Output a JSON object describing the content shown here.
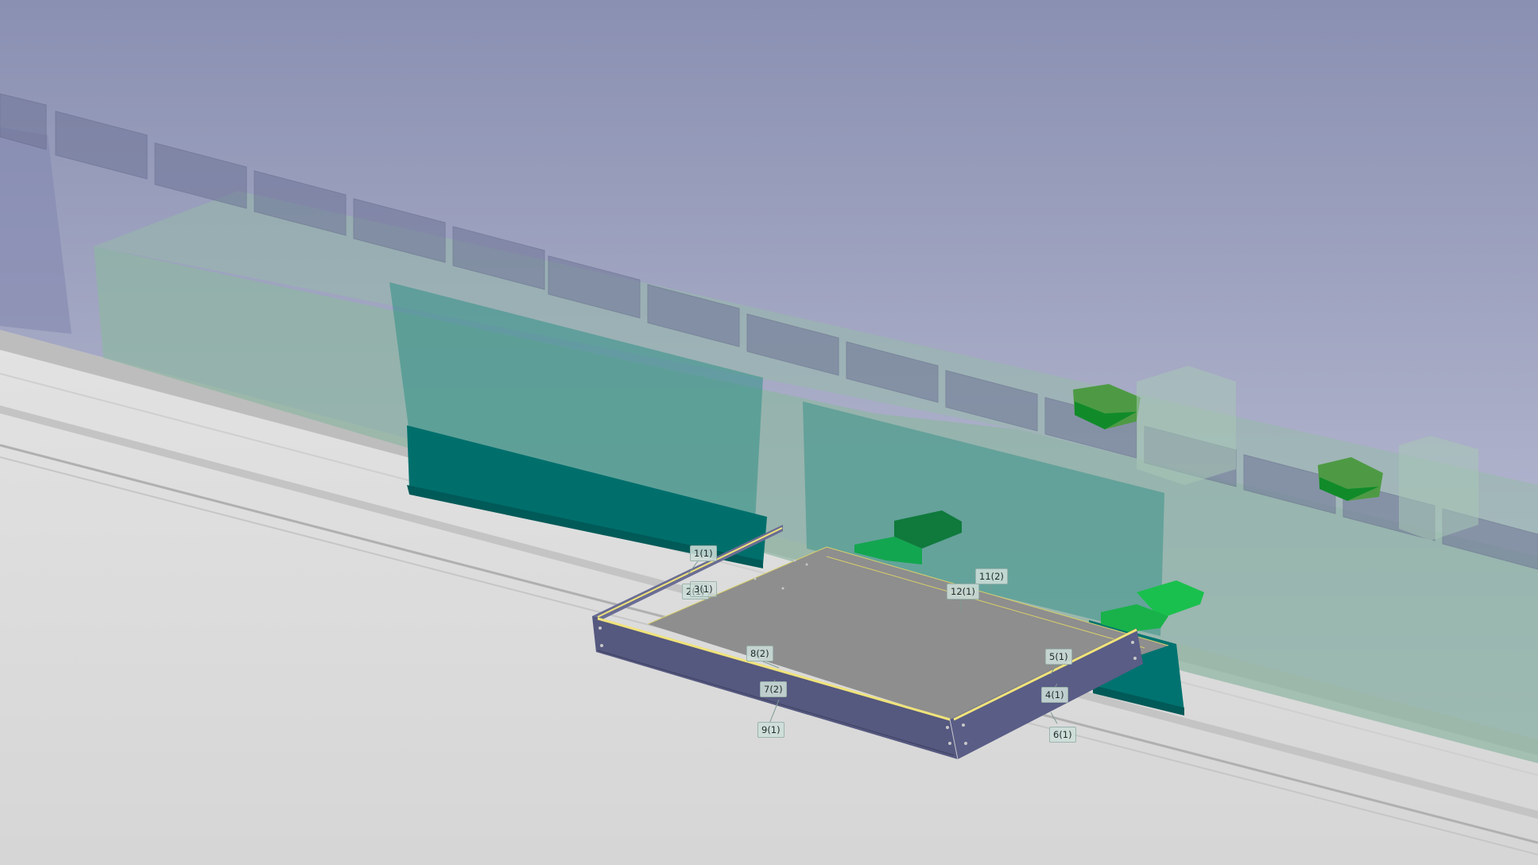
{
  "viewer": {
    "background_top": "#8c92b4",
    "background_bottom": "#c7cadc",
    "floor_color": "#d9d9d9",
    "frame_color": "#55587f",
    "frame_edge_color": "#e6dc64",
    "panel_color": "#8e8e8e",
    "teal_color": "#007070",
    "green_color": "#12b048",
    "ghost_color": "#88b3a2"
  },
  "balloons": [
    {
      "label": "1(1)"
    },
    {
      "label": "2(1)"
    },
    {
      "label": "3(1)"
    },
    {
      "label": "8(2)"
    },
    {
      "label": "7(2)"
    },
    {
      "label": "9(1)"
    },
    {
      "label": "11(2)"
    },
    {
      "label": "12(1)"
    },
    {
      "label": "5(1)"
    },
    {
      "label": "4(1)"
    },
    {
      "label": "6(1)"
    }
  ]
}
